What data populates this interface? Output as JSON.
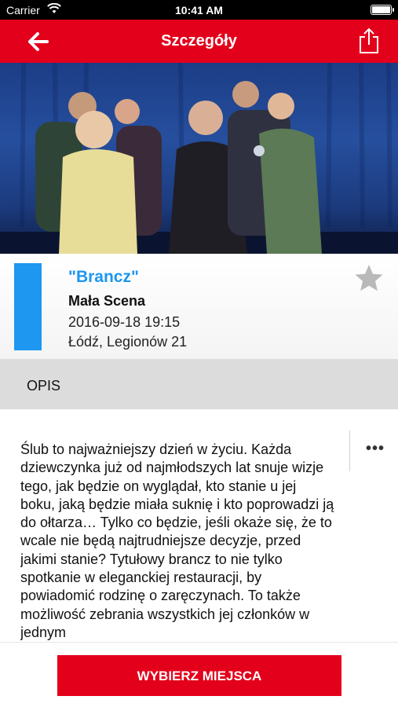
{
  "status_bar": {
    "carrier": "Carrier",
    "time": "10:41 AM"
  },
  "navbar": {
    "title": "Szczegóły",
    "back_icon": "arrow-left-icon",
    "share_icon": "share-icon"
  },
  "hero": {
    "image": "theatre-cast-photo"
  },
  "event": {
    "title": "\"Brancz\"",
    "venue": "Mała Scena",
    "datetime": "2016-09-18 19:15",
    "address": "Łódź, Legionów 21",
    "accent_color": "#1d97f0",
    "favorite_icon": "star-icon"
  },
  "section": {
    "label": "OPIS"
  },
  "description": "Ślub to najważniejszy dzień w życiu. Każda dziewczynka już od najmłodszych lat snuje wizje tego, jak będzie on wyglądał, kto stanie u jej boku, jaką będzie miała suknię i kto poprowadzi ją do ołtarza… Tylko co będzie, jeśli okaże się, że to wcale nie będą najtrudniejsze decyzje, przed jakimi stanie? Tytułowy brancz to nie tylko spotkanie w eleganckiej restauracji, by powiadomić rodzinę o zaręczynach. To także możliwość zebrania wszystkich jej członków w jednym",
  "more_label": "•••",
  "cta": {
    "label": "WYBIERZ MIEJSCA"
  },
  "colors": {
    "brand": "#e3001b",
    "accent": "#1d97f0",
    "section_bg": "#dcdcdc"
  }
}
